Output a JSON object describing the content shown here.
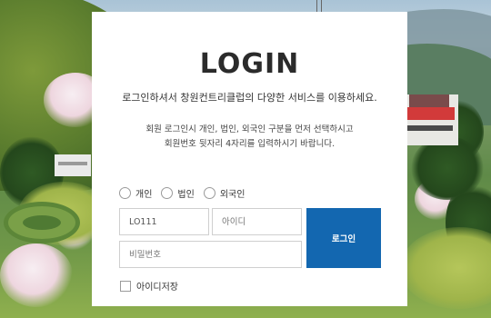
{
  "login": {
    "title": "LOGIN",
    "subtitle": "로그인하셔서 창원컨트리클럽의 다양한 서비스를 이용하세요.",
    "note_line1": "회원 로그인시 개인, 법인, 외국인 구분을 먼저 선택하시고",
    "note_line2": "회원번호 뒷자리 4자리를 입력하시기 바랍니다.",
    "member_types": [
      {
        "label": "개인",
        "selected": false
      },
      {
        "label": "법인",
        "selected": false
      },
      {
        "label": "외국인",
        "selected": false
      }
    ],
    "member_code": {
      "value": "LO111"
    },
    "user_id": {
      "value": "",
      "placeholder": "아이디"
    },
    "password": {
      "value": "",
      "placeholder": "비밀번호"
    },
    "login_button": "로그인",
    "save_id": {
      "label": "아이디저장",
      "checked": false
    }
  },
  "colors": {
    "button": "#1367b0",
    "card_background": "#ffffff"
  }
}
